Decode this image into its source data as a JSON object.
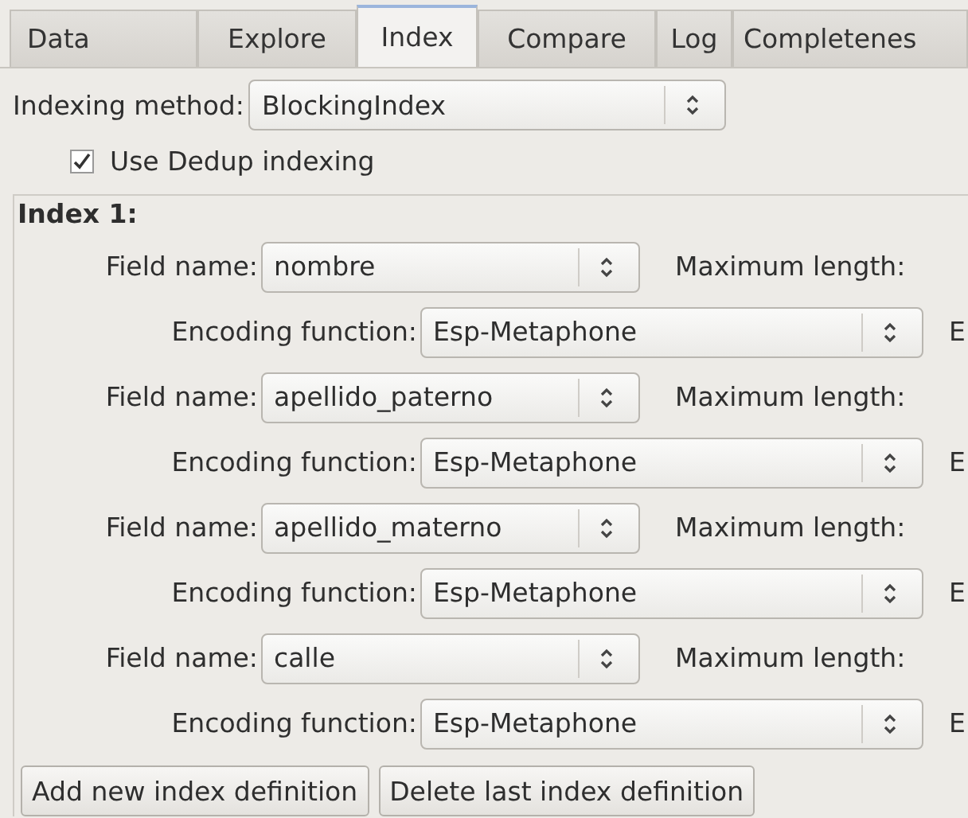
{
  "tabs": [
    {
      "label": "Data",
      "selected": false
    },
    {
      "label": "Explore",
      "selected": false
    },
    {
      "label": "Index",
      "selected": true
    },
    {
      "label": "Compare",
      "selected": false
    },
    {
      "label": "Log",
      "selected": false
    },
    {
      "label": "Completenes",
      "selected": false
    }
  ],
  "indexing_method": {
    "label": "Indexing method:",
    "value": "BlockingIndex"
  },
  "dedup": {
    "label": "Use Dedup indexing",
    "checked": true
  },
  "index_title": "Index 1:",
  "rows": [
    {
      "kind": "field",
      "label": "Field name:",
      "value": "nombre",
      "extra": "Maximum length:"
    },
    {
      "kind": "encoding",
      "label": "Encoding function:",
      "value": "Esp-Metaphone",
      "extra": "E"
    },
    {
      "kind": "field",
      "label": "Field name:",
      "value": "apellido_paterno",
      "extra": "Maximum length:"
    },
    {
      "kind": "encoding",
      "label": "Encoding function:",
      "value": "Esp-Metaphone",
      "extra": "E"
    },
    {
      "kind": "field",
      "label": "Field name:",
      "value": "apellido_materno",
      "extra": "Maximum length:"
    },
    {
      "kind": "encoding",
      "label": "Encoding function:",
      "value": "Esp-Metaphone",
      "extra": "E"
    },
    {
      "kind": "field",
      "label": "Field name:",
      "value": "calle",
      "extra": "Maximum length:"
    },
    {
      "kind": "encoding",
      "label": "Encoding function:",
      "value": "Esp-Metaphone",
      "extra": "E"
    }
  ],
  "buttons": [
    "Add new index definition",
    "Delete last index definition"
  ]
}
